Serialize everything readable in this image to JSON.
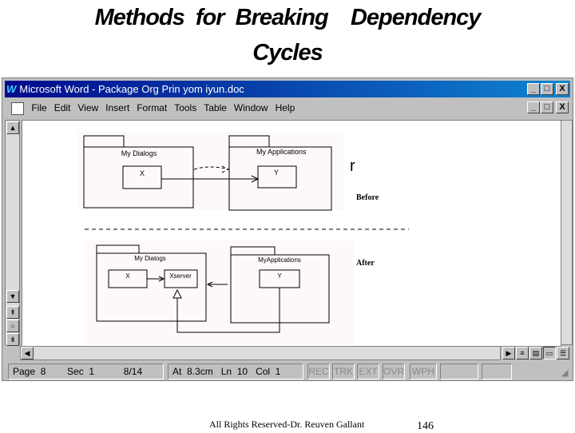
{
  "slide": {
    "title_line1": "Methods  for  Breaking    Dependency",
    "title_line2": "Cycles",
    "footer": "All Rights Reserved-Dr. Reuven Gallant",
    "page_number": "146"
  },
  "window": {
    "app_icon": "word-icon",
    "title": "Microsoft Word - Package Org Prin yom iyun.doc",
    "minimize": "_",
    "maximize": "□",
    "close": "X",
    "restore": "🗗"
  },
  "menu": [
    "File",
    "Edit",
    "View",
    "Insert",
    "Format",
    "Tools",
    "Table",
    "Window",
    "Help"
  ],
  "diagram": {
    "before": {
      "pkg1": "My Dialogs",
      "pkg2": "My Applications",
      "class1": "X",
      "class2": "Y",
      "label": "Before"
    },
    "after": {
      "pkg1": "My Dialogs",
      "pkg2": "MyApplications",
      "class1": "X",
      "class2": "Xserver",
      "class3": "Y",
      "label": "After"
    }
  },
  "statusbar": {
    "page": "Page  8",
    "sec": "Sec  1",
    "pages": "8/14",
    "at": "At  8.3cm",
    "ln": "Ln  10",
    "col": "Col  1",
    "rec": "REC",
    "trk": "TRK",
    "ext": "EXT",
    "ovr": "OVR",
    "wph": "WPH"
  }
}
